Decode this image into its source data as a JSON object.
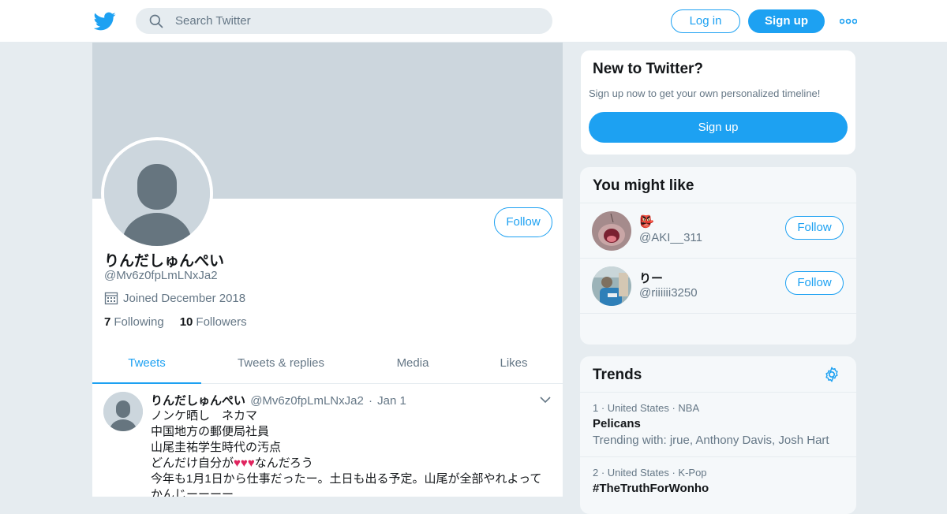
{
  "header": {
    "search_placeholder": "Search Twitter",
    "login_label": "Log in",
    "signup_label": "Sign up"
  },
  "profile": {
    "name": "りんだしゅんぺい",
    "handle": "@Mv6z0fpLmLNxJa2",
    "joined": "Joined December 2018",
    "following_count": "7",
    "following_label": "Following",
    "followers_count": "10",
    "followers_label": "Followers",
    "follow_label": "Follow"
  },
  "tabs": [
    {
      "label": "Tweets",
      "active": true
    },
    {
      "label": "Tweets & replies",
      "active": false
    },
    {
      "label": "Media",
      "active": false
    },
    {
      "label": "Likes",
      "active": false
    }
  ],
  "tweet": {
    "name": "りんだしゅんぺい",
    "handle": "@Mv6z0fpLmLNxJa2",
    "sep": "·",
    "date": "Jan 1",
    "lines": [
      "ノンケ晒し　ネカマ",
      "中国地方の郵便局社員",
      "山尾圭祐学生時代の汚点"
    ],
    "line4_pre": "どんだけ自分が",
    "line4_post": "なんだろう",
    "heart_glyph": "♥",
    "line5": "今年も1月1日から仕事だったー。土日も出る予定。山尾が全部やれよって",
    "line6": "かんじーーーー"
  },
  "signup_card": {
    "title": "New to Twitter?",
    "subtitle": "Sign up now to get your own personalized timeline!",
    "button": "Sign up"
  },
  "wtf": {
    "title": "You might like",
    "users": [
      {
        "name": "👺",
        "handle": "@AKI__311",
        "follow": "Follow"
      },
      {
        "name": "りー",
        "handle": "@riiiiii3250",
        "follow": "Follow"
      }
    ]
  },
  "trends": {
    "title": "Trends",
    "items": [
      {
        "rank": "1",
        "meta": "United States · NBA",
        "name": "Pelicans",
        "with": "Trending with: jrue, Anthony Davis, Josh Hart"
      },
      {
        "rank": "2",
        "meta": "United States · K-Pop",
        "name": "#TheTruthForWonho",
        "with": ""
      }
    ]
  },
  "colors": {
    "accent": "#1da1f2",
    "banner": "#ccd6dd",
    "secondary_text": "#657786",
    "heart": "#e0245e"
  }
}
